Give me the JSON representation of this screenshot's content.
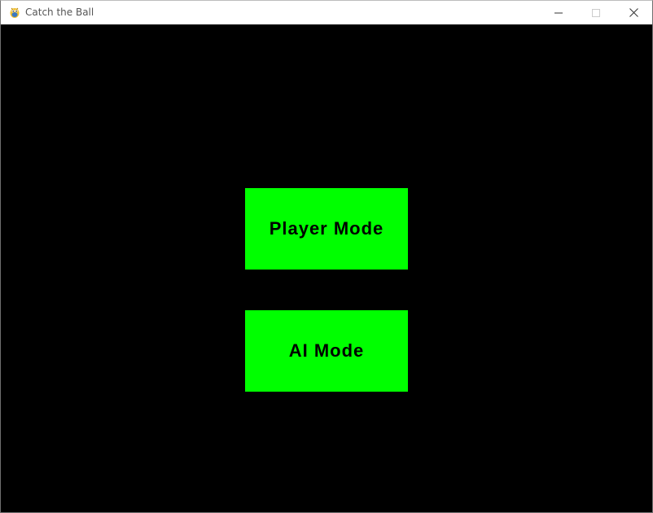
{
  "window": {
    "title": "Catch the Ball",
    "app_icon": "pygame-snake-icon",
    "controls": {
      "minimize_icon": "minimize-icon",
      "maximize_icon": "maximize-icon",
      "close_icon": "close-icon"
    }
  },
  "menu": {
    "background_color": "#000000",
    "button_color": "#00ff00",
    "button_text_color": "#000000",
    "buttons": [
      {
        "label": "Player Mode"
      },
      {
        "label": "AI Mode"
      }
    ]
  }
}
